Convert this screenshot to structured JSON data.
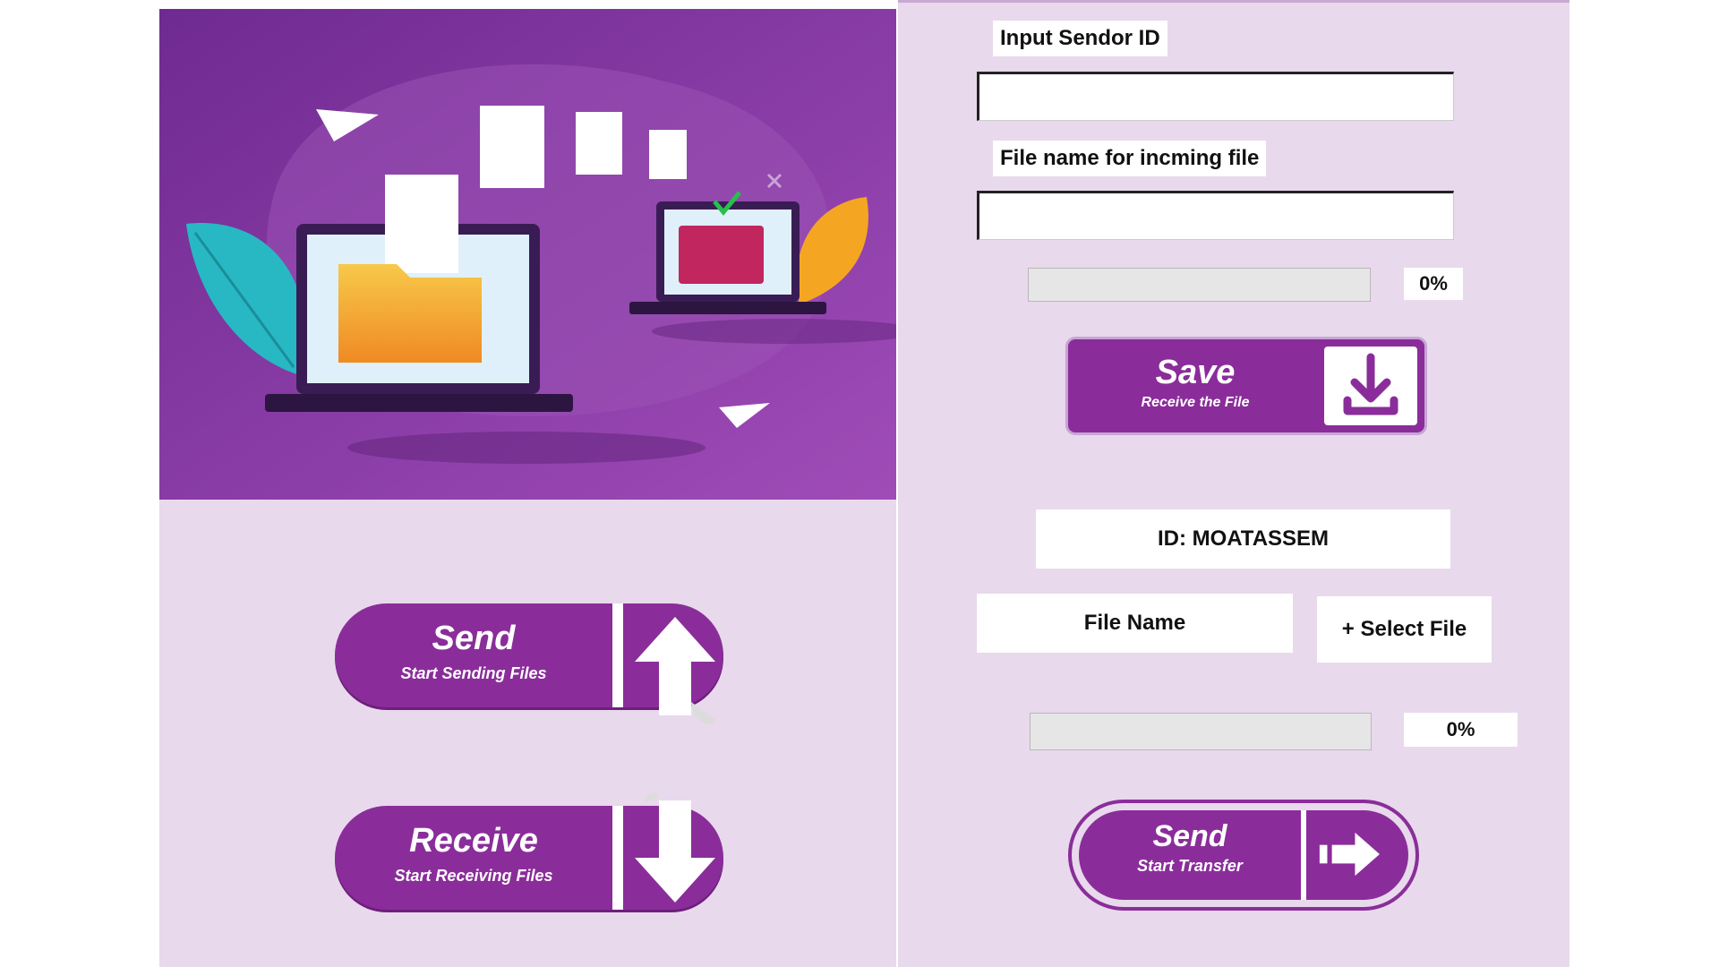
{
  "colors": {
    "accent": "#8a2d9a",
    "panel_bg": "#e8d9ec",
    "hero_bg": "#7b3199"
  },
  "left": {
    "send_button": {
      "title": "Send",
      "subtitle": "Start Sending Files",
      "icon": "arrow-up-icon"
    },
    "receive_button": {
      "title": "Receive",
      "subtitle": "Start Receiving Files",
      "icon": "arrow-down-icon"
    }
  },
  "right": {
    "sender_id_label": "Input Sendor ID",
    "sender_id_value": "",
    "incoming_name_label": "File name for incming file",
    "incoming_name_value": "",
    "receive_progress": {
      "value": 0,
      "text": "0%"
    },
    "save_button": {
      "title": "Save",
      "subtitle": "Receive the File",
      "icon": "download-icon"
    },
    "id_display": "ID: MOATASSEM",
    "file_name_display": "File Name",
    "select_file_button": "+ Select File",
    "send_progress": {
      "value": 0,
      "text": "0%"
    },
    "send_transfer_button": {
      "title": "Send",
      "subtitle": "Start Transfer",
      "icon": "arrow-right-icon"
    }
  }
}
